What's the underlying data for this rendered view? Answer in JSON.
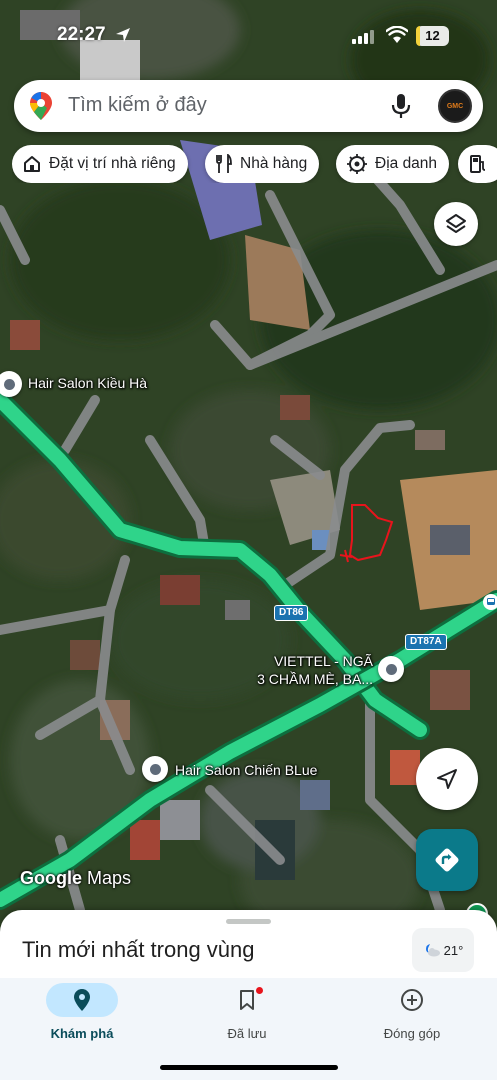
{
  "status_bar": {
    "time": "22:27",
    "battery": "12",
    "battery_level_percent": 12
  },
  "search": {
    "placeholder": "Tìm kiếm ở đây",
    "avatar_text": "GMC"
  },
  "chips": [
    {
      "label": "Đặt vị trí nhà riêng",
      "icon": "home-icon"
    },
    {
      "label": "Nhà hàng",
      "icon": "fork-knife-icon"
    },
    {
      "label": "Địa danh",
      "icon": "landmark-icon"
    },
    {
      "label": "",
      "icon": "gas-station-icon"
    }
  ],
  "map": {
    "places": [
      {
        "name": "Hair Salon Kiều Hà"
      },
      {
        "name": "Hair Salon Chiến BLue"
      },
      {
        "name_line1": "VIETTEL - NGÃ",
        "name_line2": "3 CHẦM MÈ, BA..."
      }
    ],
    "road_shields": [
      "DT86",
      "DT87A"
    ],
    "watermark": {
      "brand": "Google",
      "product": "Maps"
    },
    "colors": {
      "route": "#2fd48a",
      "road": "#8a8c8e",
      "drawn_outline": "#e8141c"
    }
  },
  "sheet": {
    "title": "Tin mới nhất trong vùng",
    "temperature": "21°"
  },
  "nav": [
    {
      "label": "Khám phá",
      "icon": "explore-pin-icon",
      "active": true
    },
    {
      "label": "Đã lưu",
      "icon": "bookmark-icon",
      "active": false,
      "badge": true
    },
    {
      "label": "Đóng góp",
      "icon": "add-circle-icon",
      "active": false
    }
  ]
}
